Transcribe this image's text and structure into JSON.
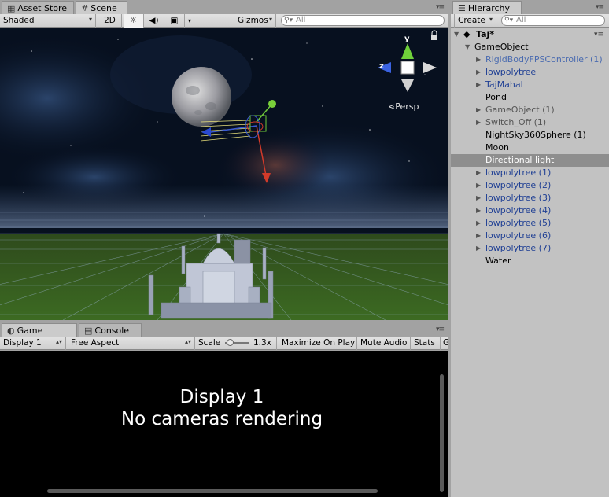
{
  "tabs_left": [
    {
      "label": "Asset Store",
      "icon": "store-icon"
    },
    {
      "label": "Scene",
      "icon": "grid-icon"
    }
  ],
  "scene_toolbar": {
    "shading": "Shaded",
    "mode_2d": "2D",
    "gizmos": "Gizmos",
    "search_placeholder": "All"
  },
  "scene": {
    "gizmo_y": "y",
    "gizmo_z": "z",
    "projection": "Persp"
  },
  "bottom_tabs": [
    {
      "label": "Game",
      "icon": "game-icon"
    },
    {
      "label": "Console",
      "icon": "console-icon"
    }
  ],
  "game_toolbar": {
    "display": "Display 1",
    "aspect": "Free Aspect",
    "scale_label": "Scale",
    "scale_value": "1.3x",
    "scale_slider_fraction": 0.1,
    "maximize": "Maximize On Play",
    "mute": "Mute Audio",
    "stats": "Stats",
    "gizmos_cut": "G"
  },
  "game": {
    "line1": "Display 1",
    "line2": "No cameras rendering"
  },
  "hierarchy": {
    "tab_label": "Hierarchy",
    "create": "Create",
    "search_placeholder": "All",
    "scene_name": "Taj*",
    "root": "GameObject",
    "items": [
      {
        "label": "RigidBodyFPSController (1)",
        "expandable": true,
        "style": "blue-light"
      },
      {
        "label": "lowpolytree",
        "expandable": true,
        "style": "blue"
      },
      {
        "label": "TajMahal",
        "expandable": true,
        "style": "blue"
      },
      {
        "label": "Pond",
        "expandable": false,
        "style": "normal"
      },
      {
        "label": "GameObject (1)",
        "expandable": true,
        "style": "grey"
      },
      {
        "label": "Switch_Off (1)",
        "expandable": true,
        "style": "grey"
      },
      {
        "label": "NightSky360Sphere (1)",
        "expandable": false,
        "style": "normal"
      },
      {
        "label": "Moon",
        "expandable": false,
        "style": "normal"
      },
      {
        "label": "Directional light",
        "expandable": false,
        "style": "selected"
      },
      {
        "label": "lowpolytree (1)",
        "expandable": true,
        "style": "blue"
      },
      {
        "label": "lowpolytree (2)",
        "expandable": true,
        "style": "blue"
      },
      {
        "label": "lowpolytree (3)",
        "expandable": true,
        "style": "blue"
      },
      {
        "label": "lowpolytree (4)",
        "expandable": true,
        "style": "blue"
      },
      {
        "label": "lowpolytree (5)",
        "expandable": true,
        "style": "blue"
      },
      {
        "label": "lowpolytree (6)",
        "expandable": true,
        "style": "blue"
      },
      {
        "label": "lowpolytree (7)",
        "expandable": true,
        "style": "blue"
      },
      {
        "label": "Water",
        "expandable": false,
        "style": "normal"
      }
    ]
  },
  "colors": {
    "selection": "#8e8e8e",
    "prefab_blue": "#1f3f94",
    "panel_bg": "#c2c2c2",
    "game_bg": "#000000"
  }
}
